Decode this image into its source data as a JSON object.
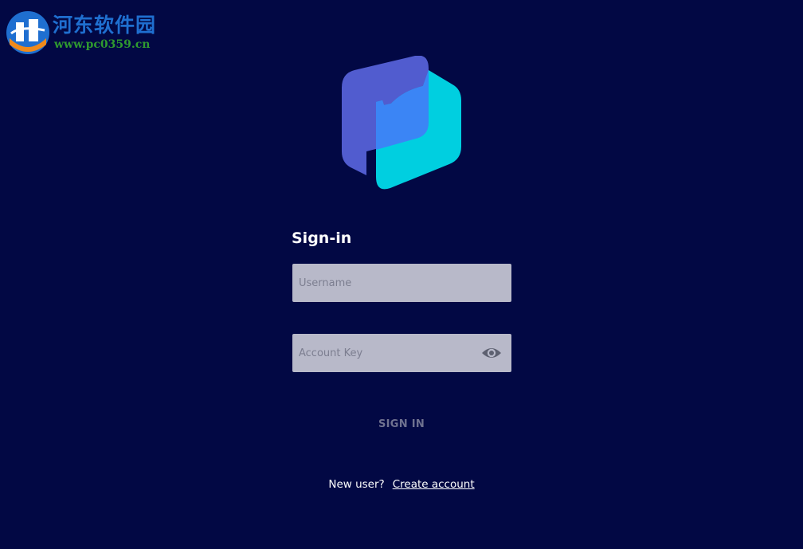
{
  "watermark": {
    "title": "河东软件园",
    "url": "www.pc0359.cn",
    "icon": "hedong-logo-icon"
  },
  "logo": {
    "icon": "app-logo-icon",
    "colors": {
      "back": "#515ccf",
      "front": "#00cfe0",
      "overlap": "#3b85f5"
    }
  },
  "signin": {
    "heading": "Sign-in",
    "username_placeholder": "Username",
    "username_value": "",
    "account_key_placeholder": "Account Key",
    "account_key_value": "",
    "reveal_icon": "eye-icon",
    "button_label": "SIGN IN"
  },
  "footer": {
    "prompt": "New user?",
    "link_label": "Create account"
  },
  "colors": {
    "background": "#020844",
    "input_background": "#b8b9c9",
    "button_text_disabled": "#6f7290"
  }
}
